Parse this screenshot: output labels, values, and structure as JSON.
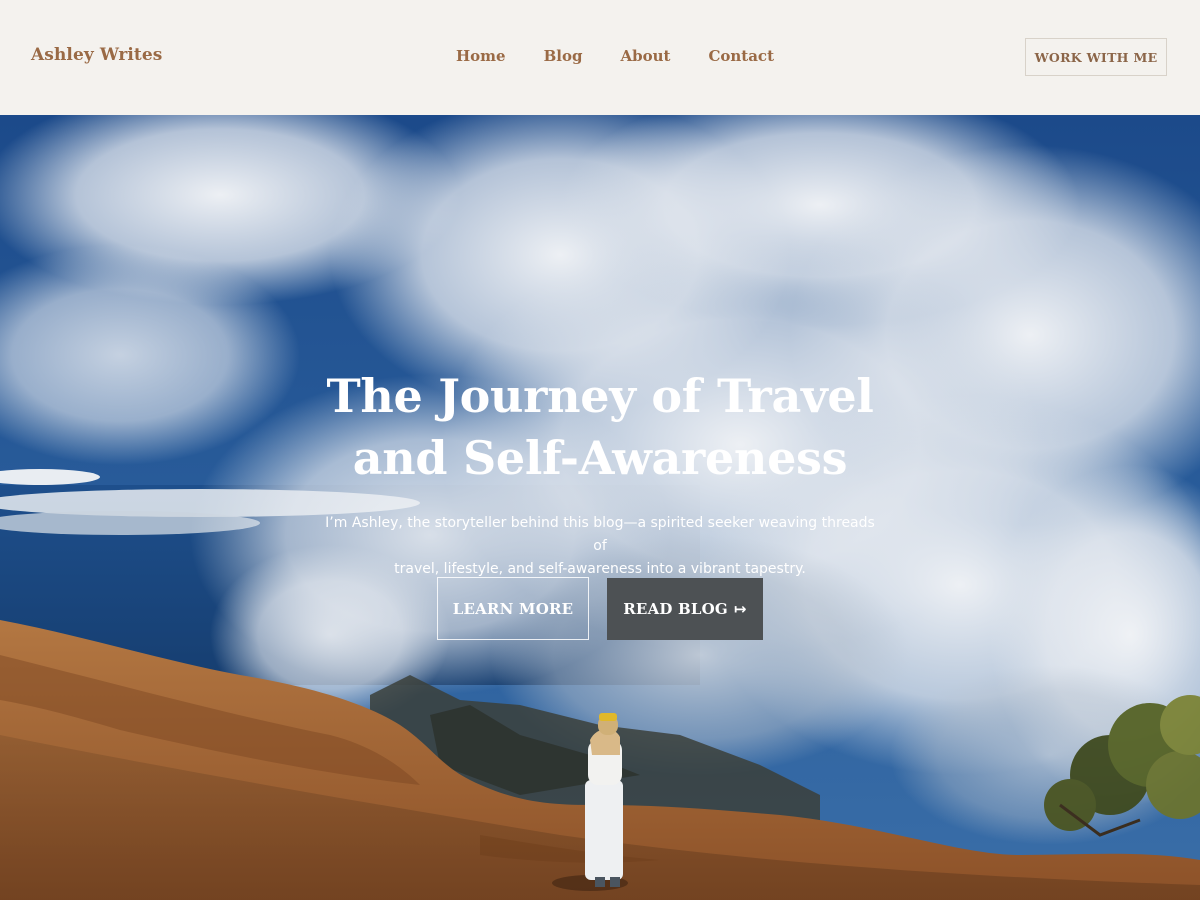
{
  "header": {
    "brand": "Ashley Writes",
    "nav": [
      "Home",
      "Blog",
      "About",
      "Contact"
    ],
    "cta_label": "WORK WITH ME"
  },
  "hero": {
    "title_line1": "The Journey of Travel",
    "title_line2": "and Self-Awareness",
    "subtitle_line1": "I’m Ashley, the storyteller behind this blog—a spirited seeker weaving threads of",
    "subtitle_line2": "travel, lifestyle, and self-awareness into a vibrant tapestry.",
    "learn_more_label": "LEARN MORE",
    "read_blog_label": "READ BLOG",
    "read_blog_icon": "arrow-right-icon"
  },
  "colors": {
    "header_bg": "#f4f2ee",
    "brand_text": "#9a6a45",
    "read_blog_bg": "#4d5154",
    "sky": "#1f4f8a",
    "ground": "#a7693a"
  }
}
